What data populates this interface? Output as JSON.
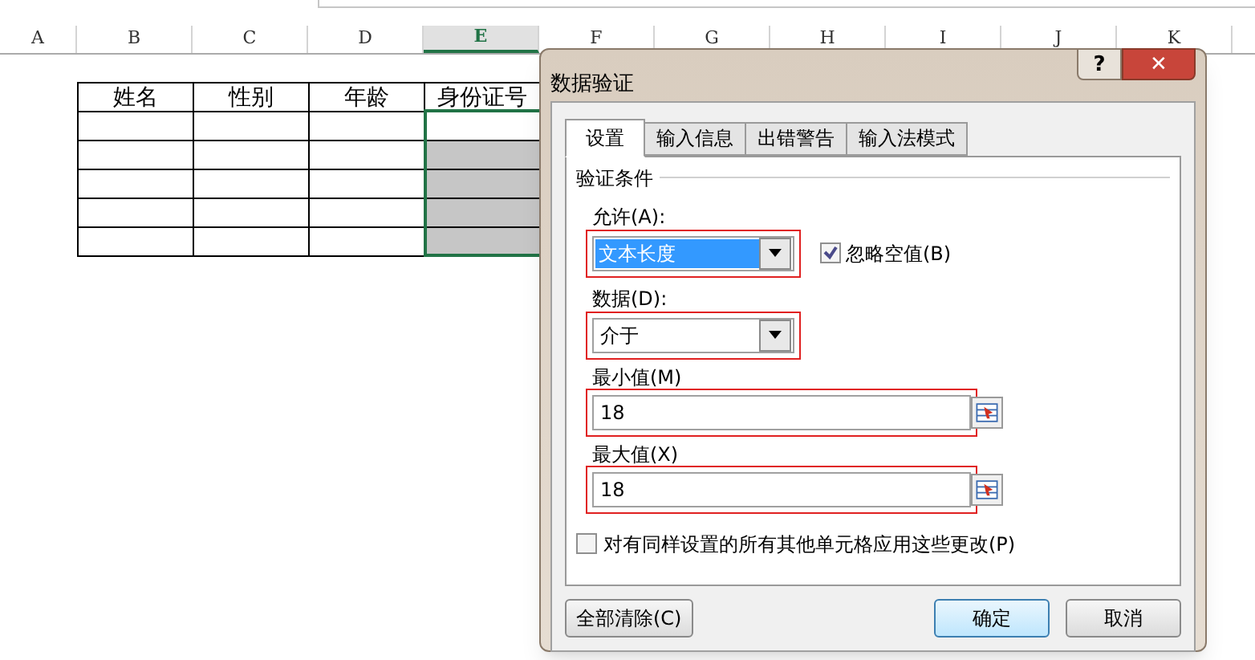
{
  "sheet": {
    "columns": [
      {
        "label": "A",
        "selected": false
      },
      {
        "label": "B",
        "selected": false
      },
      {
        "label": "C",
        "selected": false
      },
      {
        "label": "D",
        "selected": false
      },
      {
        "label": "E",
        "selected": true
      },
      {
        "label": "F",
        "selected": false
      },
      {
        "label": "G",
        "selected": false
      },
      {
        "label": "H",
        "selected": false
      },
      {
        "label": "I",
        "selected": false
      },
      {
        "label": "J",
        "selected": false
      },
      {
        "label": "K",
        "selected": false
      }
    ],
    "table": {
      "headers": [
        "姓名",
        "性别",
        "年龄",
        "身份证号"
      ],
      "rows": [
        [
          false,
          false,
          false,
          false
        ],
        [
          false,
          false,
          false,
          true
        ],
        [
          false,
          false,
          false,
          true
        ],
        [
          false,
          false,
          false,
          true
        ],
        [
          false,
          false,
          false,
          true
        ]
      ]
    }
  },
  "dialog": {
    "title": "数据验证",
    "help": "?",
    "close": "✕",
    "tabs": [
      {
        "label": "设置",
        "selected": true
      },
      {
        "label": "输入信息",
        "selected": false
      },
      {
        "label": "出错警告",
        "selected": false
      },
      {
        "label": "输入法模式",
        "selected": false
      }
    ],
    "section": "验证条件",
    "allow": {
      "label": "允许(A):",
      "value": "文本长度",
      "highlighted": true
    },
    "ignore_blank": {
      "label": "忽略空值(B)",
      "checked": true
    },
    "data": {
      "label": "数据(D):",
      "value": "介于",
      "highlighted": true
    },
    "minimum": {
      "label": "最小值(M)",
      "value": "18",
      "highlighted": true
    },
    "maximum": {
      "label": "最大值(X)",
      "value": "18",
      "highlighted": true
    },
    "apply_all": {
      "label": "对有同样设置的所有其他单元格应用这些更改(P)",
      "checked": false
    },
    "buttons": {
      "clear": "全部清除(C)",
      "ok": "确定",
      "cancel": "取消"
    }
  }
}
